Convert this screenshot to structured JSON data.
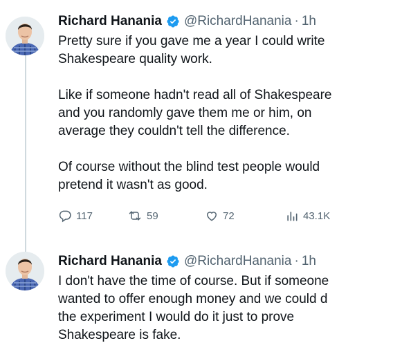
{
  "tweets": [
    {
      "name": "Richard Hanania",
      "handle": "@RichardHanania",
      "separator": "·",
      "time": "1h",
      "paragraphs": [
        "Pretty sure if you gave me a year I could write\nShakespeare quality work.",
        "Like if someone hadn't read all of Shakespeare\nand you randomly gave them me or him, on\naverage they couldn't tell the difference.",
        "Of course without the blind test people would\npretend it wasn't as good."
      ],
      "stats": {
        "replies": "117",
        "retweets": "59",
        "likes": "72",
        "views": "43.1K"
      }
    },
    {
      "name": "Richard Hanania",
      "handle": "@RichardHanania",
      "separator": "·",
      "time": "1h",
      "paragraphs": [
        "I don't have the time of course. But if someone\nwanted to offer enough money and we could d\nthe experiment I would do it just to prove\nShakespeare is fake."
      ]
    }
  ],
  "colors": {
    "verified": "#1d9bf0",
    "muted": "#536471",
    "text": "#0f1419",
    "thread_line": "#cfd9de"
  },
  "icons": [
    "reply-icon",
    "retweet-icon",
    "like-icon",
    "views-icon",
    "verified-badge-icon"
  ]
}
